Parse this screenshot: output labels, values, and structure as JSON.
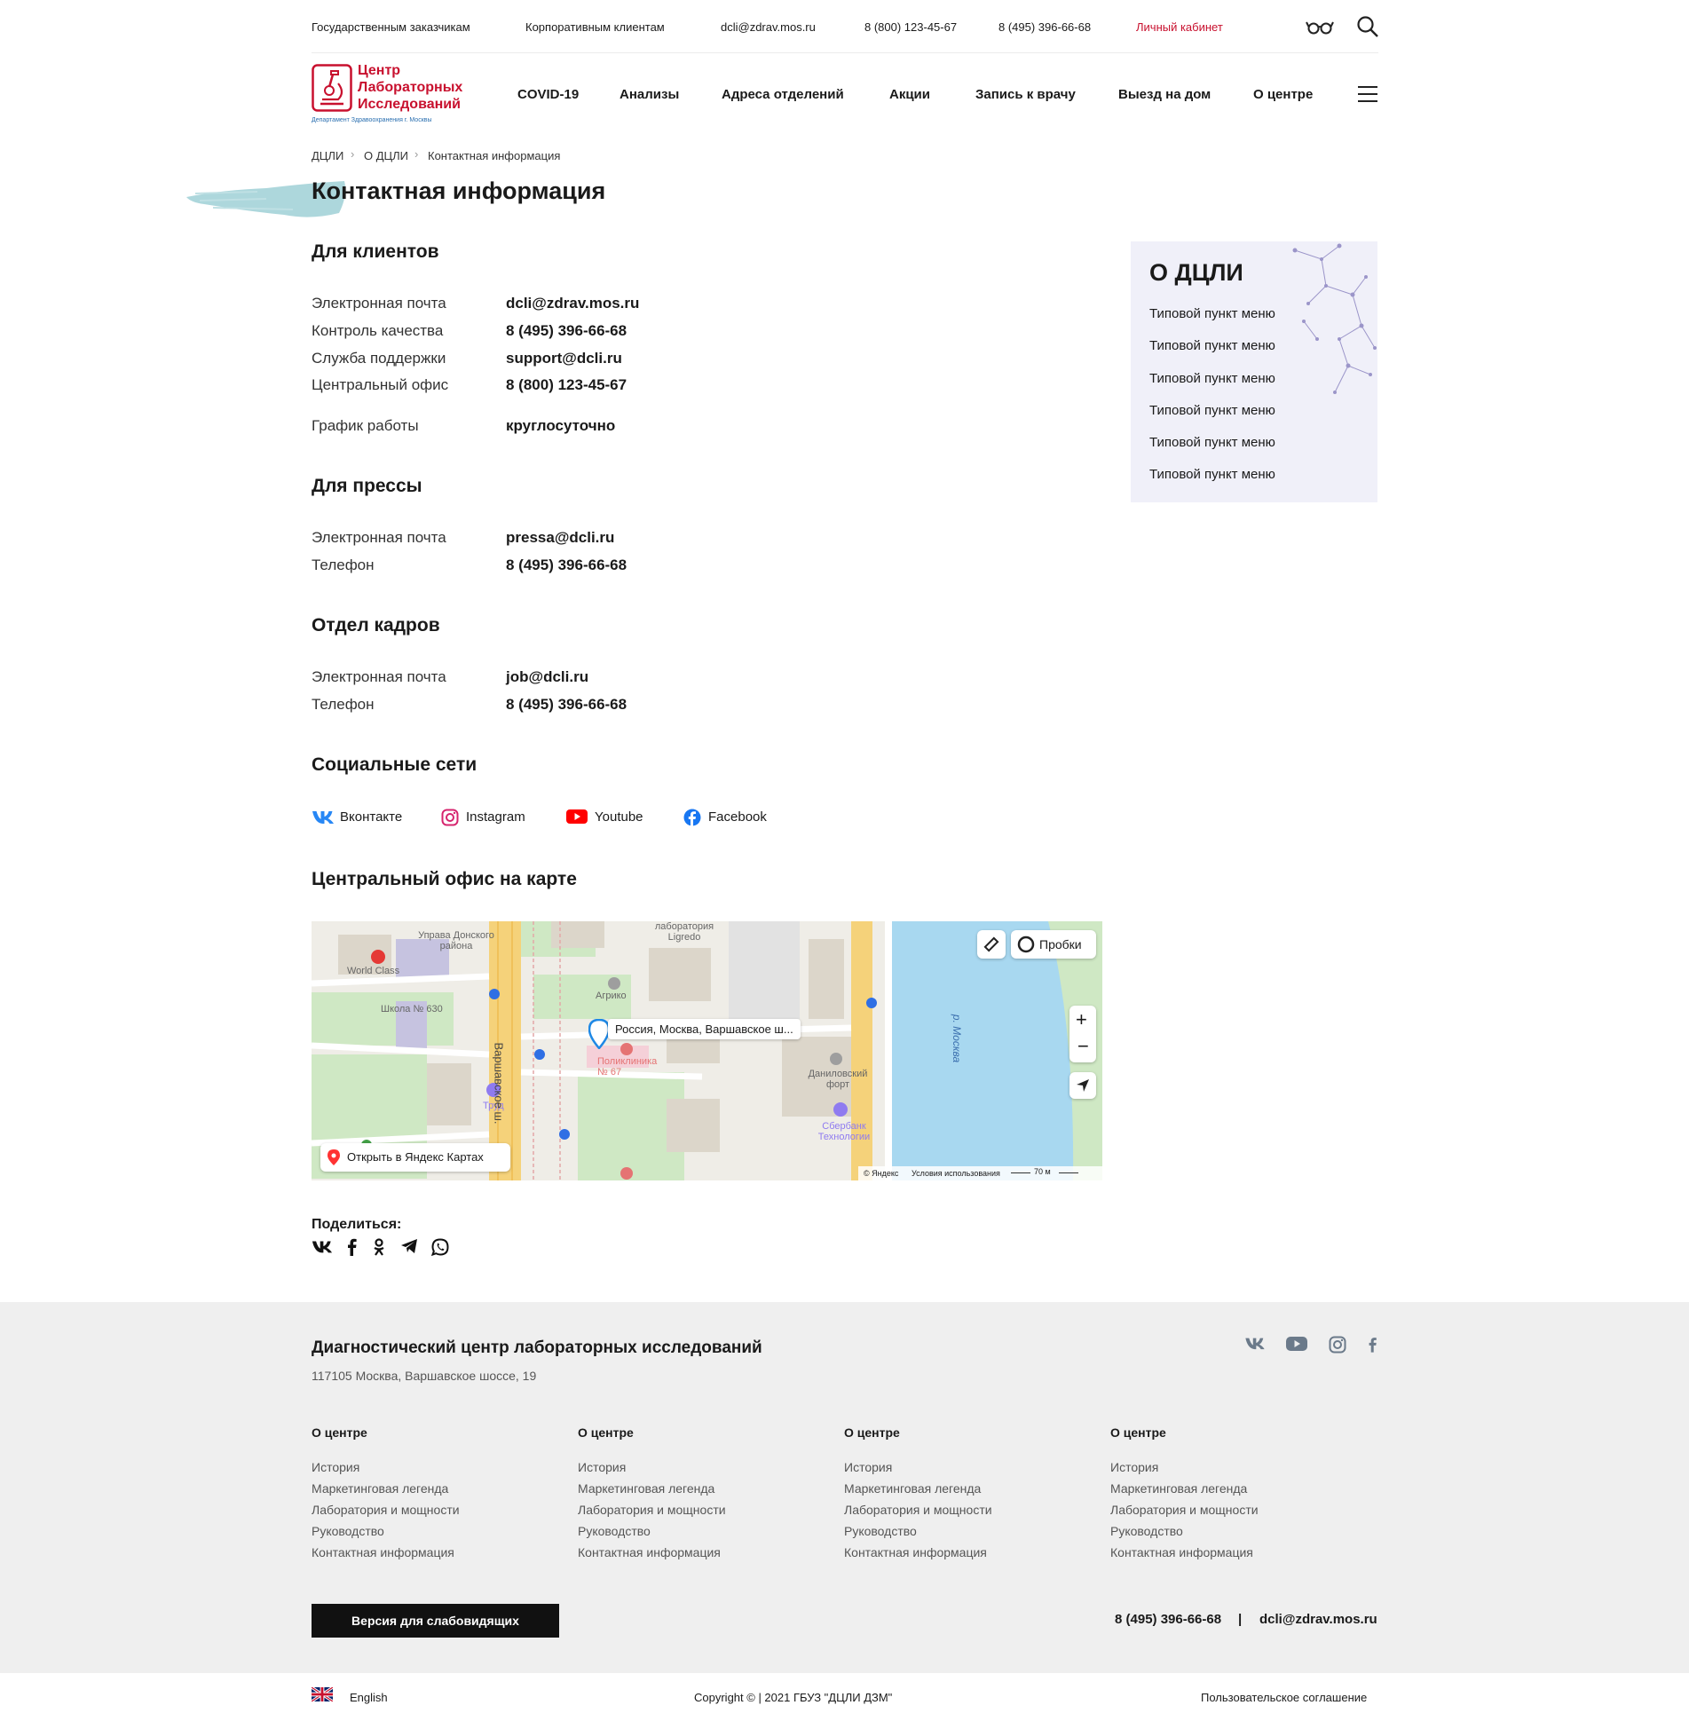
{
  "topbar": {
    "gov": "Государственным заказчикам",
    "corp": "Корпоративным клиентам",
    "email": "dcli@zdrav.mos.ru",
    "phone1": "8 (800) 123-45-67",
    "phone2": "8 (495) 396-66-68",
    "cabinet": "Личный кабинет",
    "icons": [
      "glasses-icon",
      "search-icon"
    ]
  },
  "logo": {
    "line1": "Центр",
    "line2": "Лабораторных",
    "line3": "Исследований",
    "sub": "Департамент Здравоохранения г. Москвы"
  },
  "nav": [
    "COVID-19",
    "Анализы",
    "Адреса отделений",
    "Акции",
    "Запись к врачу",
    "Выезд на дом",
    "О центре"
  ],
  "breadcrumbs": [
    "ДЦЛИ",
    "О ДЦЛИ",
    "Контактная информация"
  ],
  "page_title": "Контактная информация",
  "clients": {
    "title": "Для клиентов",
    "rows": [
      {
        "label": "Электронная почта",
        "value": "dcli@zdrav.mos.ru"
      },
      {
        "label": "Контроль качества",
        "value": "8 (495) 396-66-68"
      },
      {
        "label": "Служба поддержки",
        "value": "support@dcli.ru"
      },
      {
        "label": "Центральный офис",
        "value": "8 (800) 123-45-67"
      },
      {
        "label": "График работы",
        "value": "круглосуточно"
      }
    ]
  },
  "press": {
    "title": "Для прессы",
    "rows": [
      {
        "label": "Электронная почта",
        "value": "pressa@dcli.ru"
      },
      {
        "label": "Телефон",
        "value": "8 (495) 396-66-68"
      }
    ]
  },
  "hr": {
    "title": "Отдел кадров",
    "rows": [
      {
        "label": "Электронная почта",
        "value": "job@dcli.ru"
      },
      {
        "label": "Телефон",
        "value": "8 (495) 396-66-68"
      }
    ]
  },
  "social": {
    "title": "Социальные сети",
    "items": [
      "Вконтакте",
      "Instagram",
      "Youtube",
      "Facebook"
    ],
    "colors": {
      "vk": "#2787f5",
      "instagram": "#d6246e",
      "youtube": "#ff0000",
      "facebook": "#1877f2"
    }
  },
  "map": {
    "title": "Центральный офис на карте",
    "pin_label": "Россия, Москва, Варшавское ш...",
    "traffic": "Пробки",
    "open_in": "Открыть в Яндекс Картах",
    "copyright": "© Яндекс",
    "terms": "Условия использования",
    "scale": "70 м",
    "labels": {
      "uprava": "Управа Донского района",
      "world_class": "World Class",
      "school": "Школа № 630",
      "agriko": "Агрико",
      "clinic": "Поликлиника № 67",
      "trud": "Труд",
      "danilov": "Даниловский форт",
      "sber": "Сбербанк Технологии",
      "river": "р. Москва",
      "varsh": "Варшавское ш.",
      "lab": "лаборатория Ligredo"
    }
  },
  "share": {
    "title": "Поделиться:",
    "icons": [
      "vk-icon",
      "facebook-icon",
      "odnoklassniki-icon",
      "telegram-icon",
      "whatsapp-icon"
    ]
  },
  "sidebar": {
    "title": "О ДЦЛИ",
    "items": [
      "Типовой пункт меню",
      "Типовой пункт меню",
      "Типовой пункт меню",
      "Типовой пункт меню",
      "Типовой пункт меню",
      "Типовой пункт меню"
    ]
  },
  "footer": {
    "title": "Диагностический центр лабораторных исследований",
    "address": "117105 Москва, Варшавское шоссе, 19",
    "columns": [
      {
        "title": "О центре",
        "links": [
          "История",
          "Маркетинговая легенда",
          "Лаборатория и мощности",
          "Руководство",
          "Контактная информация"
        ]
      },
      {
        "title": "О центре",
        "links": [
          "История",
          "Маркетинговая легенда",
          "Лаборатория и мощности",
          "Руководство",
          "Контактная информация"
        ]
      },
      {
        "title": "О центре",
        "links": [
          "История",
          "Маркетинговая легенда",
          "Лаборатория и мощности",
          "Руководство",
          "Контактная информация"
        ]
      },
      {
        "title": "О центре",
        "links": [
          "История",
          "Маркетинговая легенда",
          "Лаборатория и мощности",
          "Руководство",
          "Контактная информация"
        ]
      }
    ],
    "accessibility_button": "Версия для слабовидящих",
    "phone": "8 (495) 396-66-68",
    "separator": "|",
    "email": "dcli@zdrav.mos.ru",
    "social_icons": [
      "vk-icon",
      "youtube-icon",
      "instagram-icon",
      "facebook-icon"
    ]
  },
  "bottom": {
    "language": "English",
    "copyright": "Copyright © | 2021 ГБУЗ \"ДЦЛИ ДЗМ\"",
    "agreement": "Пользовательское соглашение"
  },
  "colors": {
    "brand_red": "#c8102e",
    "sidebar_bg": "#f0f0f9",
    "footer_bg": "#efefef",
    "brush": "#9fd0d6"
  }
}
